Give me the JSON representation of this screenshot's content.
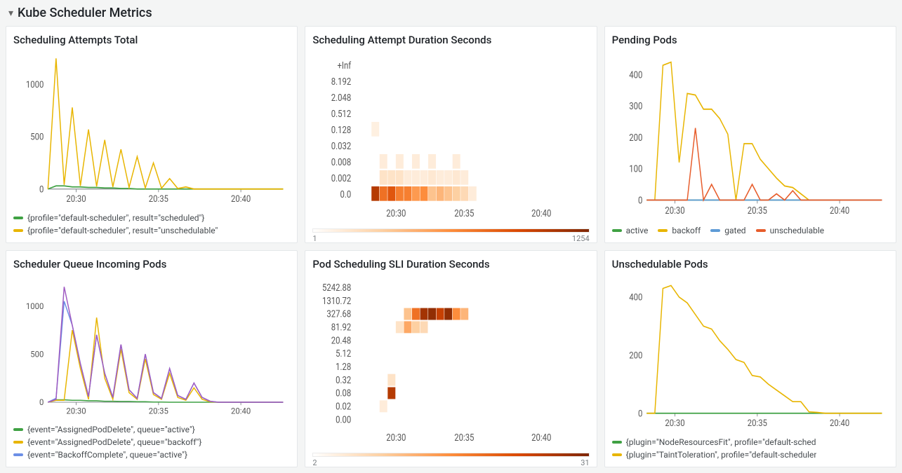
{
  "section_title": "Kube Scheduler Metrics",
  "panels": {
    "attempts": {
      "title": "Scheduling Attempts Total",
      "legend": [
        {
          "label": "{profile=\"default-scheduler\", result=\"scheduled\"}",
          "color": "#3FA143"
        },
        {
          "label": "{profile=\"default-scheduler\", result=\"unschedulable\"",
          "color": "#E8B500"
        }
      ]
    },
    "attempt_duration": {
      "title": "Scheduling Attempt Duration Seconds",
      "color_min": "1",
      "color_max": "1254"
    },
    "pending": {
      "title": "Pending Pods",
      "legend": [
        {
          "label": "active",
          "color": "#3FA143"
        },
        {
          "label": "backoff",
          "color": "#E8B500"
        },
        {
          "label": "gated",
          "color": "#5E9BD6"
        },
        {
          "label": "unschedulable",
          "color": "#E75D2C"
        }
      ]
    },
    "queue_incoming": {
      "title": "Scheduler Queue Incoming Pods",
      "legend": [
        {
          "label": "{event=\"AssignedPodDelete\", queue=\"active\"}",
          "color": "#3FA143"
        },
        {
          "label": "{event=\"AssignedPodDelete\", queue=\"backoff\"}",
          "color": "#E8B500"
        },
        {
          "label": "{event=\"BackoffComplete\", queue=\"active\"}",
          "color": "#6C8FE6"
        }
      ]
    },
    "sli_duration": {
      "title": "Pod Scheduling SLI Duration Seconds",
      "color_min": "2",
      "color_max": "31"
    },
    "unschedulable": {
      "title": "Unschedulable Pods",
      "legend": [
        {
          "label": "{plugin=\"NodeResourcesFit\", profile=\"default-sched",
          "color": "#3FA143"
        },
        {
          "label": "{plugin=\"TaintToleration\", profile=\"default-scheduler",
          "color": "#E8B500"
        }
      ]
    }
  },
  "chart_data": [
    {
      "panel": "attempts",
      "type": "line",
      "x_ticks": [
        "20:30",
        "20:35",
        "20:40"
      ],
      "y_ticks": [
        0,
        500,
        1000
      ],
      "ylim": [
        0,
        1250
      ],
      "series": [
        {
          "name": "scheduled",
          "color": "#3FA143",
          "values": [
            0,
            30,
            30,
            20,
            20,
            15,
            15,
            10,
            10,
            5,
            5,
            0,
            0,
            0,
            0,
            0,
            0,
            0,
            0,
            0,
            0,
            0,
            0,
            0,
            0,
            0,
            0,
            0,
            0,
            0
          ]
        },
        {
          "name": "unschedulable",
          "color": "#E8B500",
          "values": [
            0,
            1250,
            40,
            780,
            30,
            570,
            25,
            470,
            20,
            380,
            15,
            310,
            10,
            250,
            8,
            100,
            5,
            20,
            0,
            0,
            0,
            0,
            0,
            0,
            0,
            0,
            0,
            0,
            0,
            0
          ]
        }
      ]
    },
    {
      "panel": "attempt_duration",
      "type": "heatmap",
      "x_ticks": [
        "20:30",
        "20:35",
        "20:40"
      ],
      "y_ticks": [
        "0.0",
        "0.002",
        "0.008",
        "0.032",
        "0.128",
        "0.512",
        "2.048",
        "8.192",
        "+Inf"
      ],
      "colorbar": {
        "min": 1,
        "max": 1254
      },
      "cells": [
        {
          "x": 2,
          "y": 0,
          "v": 0.85
        },
        {
          "x": 3,
          "y": 0,
          "v": 0.6
        },
        {
          "x": 4,
          "y": 0,
          "v": 0.7
        },
        {
          "x": 5,
          "y": 0,
          "v": 0.55
        },
        {
          "x": 6,
          "y": 0,
          "v": 0.55
        },
        {
          "x": 7,
          "y": 0,
          "v": 0.45
        },
        {
          "x": 8,
          "y": 0,
          "v": 0.5
        },
        {
          "x": 9,
          "y": 0,
          "v": 0.3
        },
        {
          "x": 10,
          "y": 0,
          "v": 0.35
        },
        {
          "x": 11,
          "y": 0,
          "v": 0.3
        },
        {
          "x": 12,
          "y": 0,
          "v": 0.25
        },
        {
          "x": 13,
          "y": 0,
          "v": 0.2
        },
        {
          "x": 14,
          "y": 0,
          "v": 0.1
        },
        {
          "x": 3,
          "y": 1,
          "v": 0.15
        },
        {
          "x": 4,
          "y": 1,
          "v": 0.15
        },
        {
          "x": 5,
          "y": 1,
          "v": 0.15
        },
        {
          "x": 6,
          "y": 1,
          "v": 0.1
        },
        {
          "x": 7,
          "y": 1,
          "v": 0.1
        },
        {
          "x": 8,
          "y": 1,
          "v": 0.1
        },
        {
          "x": 9,
          "y": 1,
          "v": 0.12
        },
        {
          "x": 10,
          "y": 1,
          "v": 0.1
        },
        {
          "x": 11,
          "y": 1,
          "v": 0.1
        },
        {
          "x": 12,
          "y": 1,
          "v": 0.12
        },
        {
          "x": 13,
          "y": 1,
          "v": 0.1
        },
        {
          "x": 3,
          "y": 2,
          "v": 0.1
        },
        {
          "x": 5,
          "y": 2,
          "v": 0.1
        },
        {
          "x": 7,
          "y": 2,
          "v": 0.1
        },
        {
          "x": 9,
          "y": 2,
          "v": 0.1
        },
        {
          "x": 12,
          "y": 2,
          "v": 0.1
        },
        {
          "x": 2,
          "y": 4,
          "v": 0.08
        }
      ]
    },
    {
      "panel": "pending",
      "type": "line",
      "x_ticks": [
        "20:30",
        "20:35",
        "20:40"
      ],
      "y_ticks": [
        0,
        100,
        200,
        300,
        400
      ],
      "ylim": [
        0,
        450
      ],
      "series": [
        {
          "name": "active",
          "color": "#3FA143",
          "values": [
            0,
            0,
            0,
            0,
            0,
            0,
            0,
            0,
            0,
            0,
            0,
            0,
            0,
            0,
            0,
            0,
            0,
            0,
            0,
            0,
            0,
            0,
            0,
            0,
            0,
            0,
            0,
            0,
            0,
            0
          ]
        },
        {
          "name": "backoff",
          "color": "#E8B500",
          "values": [
            0,
            0,
            430,
            440,
            120,
            340,
            335,
            290,
            290,
            260,
            210,
            0,
            180,
            180,
            130,
            100,
            70,
            45,
            40,
            20,
            0,
            0,
            0,
            0,
            0,
            0,
            0,
            0,
            0,
            0
          ]
        },
        {
          "name": "gated",
          "color": "#5E9BD6",
          "values": [
            0,
            0,
            0,
            0,
            0,
            0,
            0,
            0,
            0,
            0,
            0,
            0,
            0,
            0,
            0,
            0,
            0,
            0,
            0,
            0,
            0,
            0,
            0,
            0,
            0,
            0,
            0,
            0,
            0,
            0
          ]
        },
        {
          "name": "unschedulable",
          "color": "#E75D2C",
          "values": [
            0,
            0,
            0,
            0,
            0,
            0,
            230,
            0,
            50,
            0,
            0,
            0,
            0,
            50,
            0,
            0,
            20,
            0,
            30,
            0,
            0,
            0,
            0,
            0,
            0,
            0,
            0,
            0,
            0,
            0
          ]
        }
      ]
    },
    {
      "panel": "queue_incoming",
      "type": "line",
      "x_ticks": [
        "20:30",
        "20:35",
        "20:40"
      ],
      "y_ticks": [
        0,
        500,
        1000
      ],
      "ylim": [
        0,
        1250
      ],
      "series": [
        {
          "name": "green",
          "color": "#3FA143",
          "values": [
            0,
            25,
            25,
            20,
            20,
            15,
            15,
            10,
            10,
            8,
            8,
            5,
            5,
            2,
            2,
            0,
            0,
            0,
            0,
            0,
            0,
            0,
            0,
            0,
            0,
            0,
            0,
            0,
            0,
            0
          ]
        },
        {
          "name": "yellow",
          "color": "#E8B500",
          "values": [
            0,
            20,
            20,
            750,
            350,
            30,
            880,
            250,
            30,
            550,
            100,
            30,
            450,
            80,
            30,
            300,
            50,
            20,
            150,
            30,
            5,
            0,
            0,
            0,
            0,
            0,
            0,
            0,
            0,
            0
          ]
        },
        {
          "name": "blue",
          "color": "#6C8FE6",
          "values": [
            0,
            40,
            1050,
            800,
            400,
            60,
            700,
            300,
            50,
            600,
            130,
            40,
            500,
            100,
            40,
            350,
            70,
            30,
            200,
            50,
            10,
            0,
            0,
            0,
            0,
            0,
            0,
            0,
            0,
            0
          ]
        },
        {
          "name": "purple",
          "color": "#A05BC2",
          "values": [
            0,
            30,
            1200,
            800,
            400,
            60,
            700,
            300,
            50,
            600,
            130,
            40,
            500,
            100,
            40,
            350,
            70,
            30,
            200,
            50,
            10,
            0,
            0,
            0,
            0,
            0,
            0,
            0,
            0,
            0
          ]
        }
      ]
    },
    {
      "panel": "sli_duration",
      "type": "heatmap",
      "x_ticks": [
        "20:30",
        "20:35",
        "20:40"
      ],
      "y_ticks": [
        "0.00",
        "0.02",
        "0.08",
        "0.32",
        "1.28",
        "5.12",
        "20.48",
        "81.92",
        "327.68",
        "1310.72",
        "5242.88"
      ],
      "colorbar": {
        "min": 2,
        "max": 31
      },
      "cells": [
        {
          "x": 3,
          "y": 1,
          "v": 0.1
        },
        {
          "x": 4,
          "y": 2,
          "v": 0.85
        },
        {
          "x": 4,
          "y": 3,
          "v": 0.15
        },
        {
          "x": 5,
          "y": 7,
          "v": 0.15
        },
        {
          "x": 6,
          "y": 7,
          "v": 0.4
        },
        {
          "x": 6,
          "y": 8,
          "v": 0.3
        },
        {
          "x": 7,
          "y": 7,
          "v": 0.25
        },
        {
          "x": 7,
          "y": 8,
          "v": 0.6
        },
        {
          "x": 8,
          "y": 7,
          "v": 0.2
        },
        {
          "x": 8,
          "y": 8,
          "v": 0.9
        },
        {
          "x": 9,
          "y": 8,
          "v": 0.95
        },
        {
          "x": 10,
          "y": 8,
          "v": 0.8
        },
        {
          "x": 11,
          "y": 8,
          "v": 0.95
        },
        {
          "x": 12,
          "y": 8,
          "v": 0.5
        },
        {
          "x": 13,
          "y": 8,
          "v": 0.35
        }
      ]
    },
    {
      "panel": "unschedulable",
      "type": "line",
      "x_ticks": [
        "20:30",
        "20:35",
        "20:40"
      ],
      "y_ticks": [
        0,
        200,
        400
      ],
      "ylim": [
        0,
        450
      ],
      "series": [
        {
          "name": "nodefit",
          "color": "#3FA143",
          "values": [
            0,
            0,
            0,
            0,
            0,
            0,
            0,
            0,
            0,
            0,
            0,
            0,
            0,
            0,
            0,
            0,
            0,
            0,
            0,
            0,
            0,
            0,
            0,
            0,
            0,
            0,
            0,
            0,
            0,
            0
          ]
        },
        {
          "name": "taint",
          "color": "#E8B500",
          "values": [
            0,
            0,
            430,
            440,
            400,
            380,
            340,
            300,
            290,
            250,
            220,
            185,
            175,
            130,
            125,
            100,
            80,
            60,
            40,
            40,
            5,
            3,
            0,
            0,
            0,
            0,
            0,
            0,
            0,
            0
          ]
        }
      ]
    }
  ]
}
